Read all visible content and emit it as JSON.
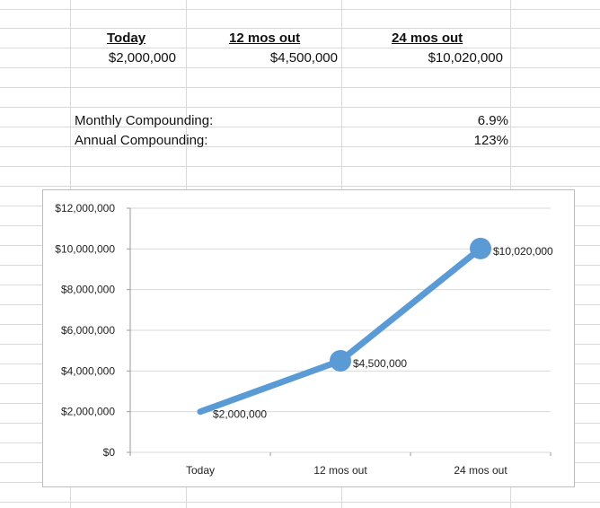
{
  "table": {
    "headers": [
      "Today",
      "12 mos out",
      "24 mos out"
    ],
    "values": [
      "$2,000,000",
      "$4,500,000",
      "$10,020,000"
    ],
    "metrics": [
      {
        "label": "Monthly Compounding:",
        "value": "6.9%"
      },
      {
        "label": "Annual Compounding:",
        "value": "123%"
      }
    ]
  },
  "colors": {
    "series": "#5b9bd5",
    "grid": "#d9d9d9"
  },
  "chart_data": {
    "type": "line",
    "categories": [
      "Today",
      "12 mos out",
      "24 mos out"
    ],
    "series": [
      {
        "values": [
          2000000,
          4500000,
          10020000
        ],
        "data_labels": [
          "$2,000,000",
          "$4,500,000",
          "$10,020,000"
        ]
      }
    ],
    "y_ticks": [
      "$0",
      "$2,000,000",
      "$4,000,000",
      "$6,000,000",
      "$8,000,000",
      "$10,000,000",
      "$12,000,000"
    ],
    "ylim": [
      0,
      12000000
    ],
    "grid": true,
    "legend": "none"
  }
}
